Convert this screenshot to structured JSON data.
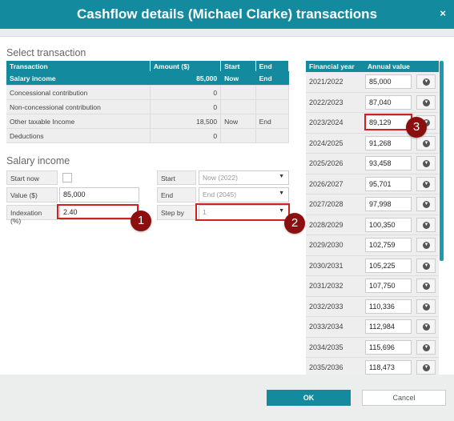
{
  "dialog": {
    "title": "Cashflow details (Michael Clarke) transactions",
    "close_icon": "×"
  },
  "select_section": {
    "title": "Select transaction",
    "columns": [
      "Transaction",
      "Amount ($)",
      "Start",
      "End"
    ],
    "rows": [
      {
        "name": "Salary income",
        "amount": "85,000",
        "start": "Now",
        "end": "End",
        "selected": true
      },
      {
        "name": "Concessional contribution",
        "amount": "0",
        "start": "",
        "end": ""
      },
      {
        "name": "Non-concessional contribution",
        "amount": "0",
        "start": "",
        "end": ""
      },
      {
        "name": "Other taxable Income",
        "amount": "18,500",
        "start": "Now",
        "end": "End"
      },
      {
        "name": "Deductions",
        "amount": "0",
        "start": "",
        "end": ""
      }
    ]
  },
  "salary_section": {
    "title": "Salary income",
    "start_now_label": "Start now",
    "value_label": "Value ($)",
    "value": "85,000",
    "indexation_label": "Indexation (%)",
    "indexation": "2.40",
    "start_label": "Start",
    "start_value": "Now (2022)",
    "end_label": "End",
    "end_value": "End (2045)",
    "step_label": "Step by",
    "step_value": "1"
  },
  "years_panel": {
    "columns": [
      "Financial year",
      "Annual value"
    ],
    "rows": [
      {
        "year": "2021/2022",
        "value": "85,000"
      },
      {
        "year": "2022/2023",
        "value": "87,040"
      },
      {
        "year": "2023/2024",
        "value": "89,129"
      },
      {
        "year": "2024/2025",
        "value": "91,268"
      },
      {
        "year": "2025/2026",
        "value": "93,458"
      },
      {
        "year": "2026/2027",
        "value": "95,701"
      },
      {
        "year": "2027/2028",
        "value": "97,998"
      },
      {
        "year": "2028/2029",
        "value": "100,350"
      },
      {
        "year": "2029/2030",
        "value": "102,759"
      },
      {
        "year": "2030/2031",
        "value": "105,225"
      },
      {
        "year": "2031/2032",
        "value": "107,750"
      },
      {
        "year": "2032/2033",
        "value": "110,336"
      },
      {
        "year": "2033/2034",
        "value": "112,984"
      },
      {
        "year": "2034/2035",
        "value": "115,696"
      },
      {
        "year": "2035/2036",
        "value": "118,473"
      },
      {
        "year": "",
        "value": ""
      }
    ]
  },
  "annotations": {
    "badge1": "1",
    "badge2": "2",
    "badge3": "3"
  },
  "footer": {
    "ok_label": "OK",
    "cancel_label": "Cancel"
  },
  "colors": {
    "accent": "#138a9e",
    "callout": "#d02020",
    "badge": "#8c0f0f"
  },
  "icons": {
    "row_action": "chevron-down-circle-icon",
    "select_caret": "caret-down-icon",
    "close": "close-icon"
  }
}
